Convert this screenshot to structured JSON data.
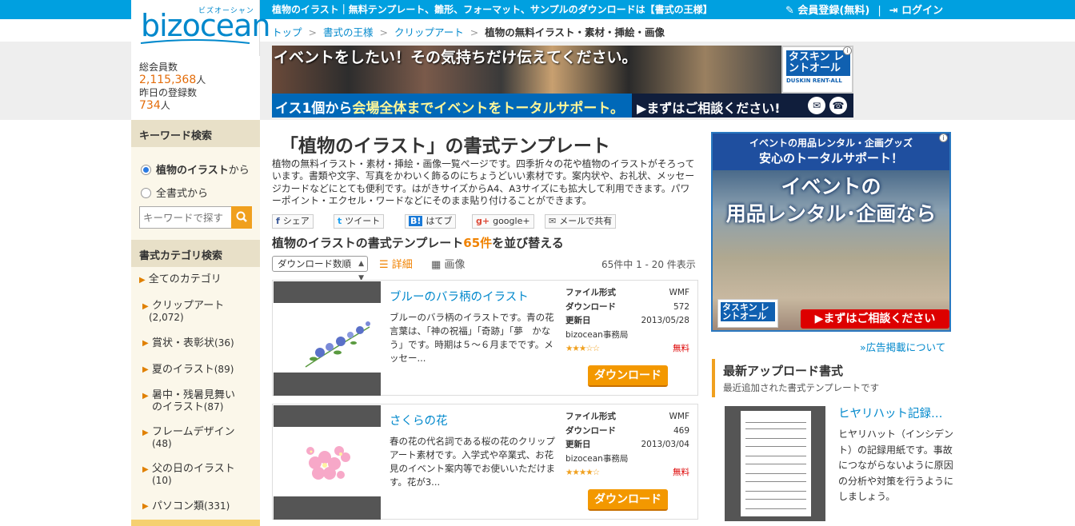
{
  "header": {
    "tagline": "植物のイラスト｜無料テンプレート、雛形、フォーマット、サンプルのダウンロードは【書式の王様】",
    "register": "会員登録(無料)",
    "separator": "|",
    "login": "ログイン"
  },
  "logo": {
    "brand": "bizocean",
    "kana": "ビズオーシャン"
  },
  "members": {
    "total_label": "総会員数",
    "total_value": "2,115,368",
    "unit": "人",
    "yesterday_label": "昨日の登録数",
    "yesterday_value": "734"
  },
  "breadcrumb": [
    "トップ",
    "書式の王様",
    "クリップアート",
    "植物の無料イラスト・素材・挿絵・画像"
  ],
  "banner_top": {
    "headline": "イベントをしたい！その気持ちだけ伝えてください。",
    "bar_text_a": "イス1個から",
    "bar_text_b": "会場全体まで",
    "bar_text_c": "イベントをトータルサポート。",
    "cta": "▶まずはご相談ください!",
    "logo_text": "タスキン レントオール",
    "logo_sub": "DUSKIN RENT-ALL"
  },
  "sidebar": {
    "keyword_head": "キーワード検索",
    "radio_this": "植物のイラスト",
    "radio_this_suffix": "から",
    "radio_all": "全書式から",
    "search_placeholder": "キーワードで探す",
    "category_head": "書式カテゴリ検索",
    "categories": [
      {
        "label": "全てのカテゴリ",
        "count": ""
      },
      {
        "label": "クリップアート",
        "count": "(2,072)"
      },
      {
        "label": "賞状・表彰状",
        "count": "(36)"
      },
      {
        "label": "夏のイラスト",
        "count": "(89)"
      },
      {
        "label": "暑中・残暑見舞いのイラスト",
        "count": "(87)"
      },
      {
        "label": "フレームデザイン",
        "count": "(48)"
      },
      {
        "label": "父の日のイラスト",
        "count": "(10)"
      },
      {
        "label": "パソコン類",
        "count": "(331)"
      }
    ]
  },
  "main": {
    "title": "「植物のイラスト」の書式テンプレート",
    "description": "植物の無料イラスト・素材・挿絵・画像一覧ページです。四季折々の花や植物のイラストがそろっています。書類や文字、写真をかわいく飾るのにちょうどいい素材です。案内状や、お礼状、メッセージカードなどにとても便利です。はがきサイズからA4、A3サイズにも拡大して利用できます。パワーポイント・エクセル・ワードなどにそのまま貼り付けることができます。",
    "share": [
      {
        "icon": "f",
        "label": "シェア"
      },
      {
        "icon": "t",
        "label": "ツイート"
      },
      {
        "icon": "B!",
        "label": "はてブ"
      },
      {
        "icon": "g+",
        "label": "google+"
      },
      {
        "icon": "✉",
        "label": "メールで共有"
      }
    ],
    "sort_title_a": "植物のイラストの書式テンプレート",
    "sort_count": "65件",
    "sort_title_b": "を並び替える",
    "sort_select": "ダウンロード数順",
    "view_detail": "詳細",
    "view_image": "画像",
    "range": "65件中 1 - 20 件表示",
    "items": [
      {
        "name": "ブルーのバラ柄のイラスト",
        "desc": "ブルーのバラ柄のイラストです。青の花言葉は、「神の祝福」「奇跡」「夢　かなう」です。時期は５～６月までです。メッセー...",
        "format_label": "ファイル形式",
        "format": "WMF",
        "downloads_label": "ダウンロード",
        "downloads": "572",
        "updated_label": "更新日",
        "updated": "2013/05/28",
        "author": "bizocean事務局",
        "rating": 3,
        "stars": "★★★☆☆",
        "price": "無料",
        "download_btn": "ダウンロード"
      },
      {
        "name": "さくらの花",
        "desc": "春の花の代名詞である桜の花のクリップアート素材です。入学式や卒業式、お花見のイベント案内等でお使いいただけます。花が3...",
        "format_label": "ファイル形式",
        "format": "WMF",
        "downloads_label": "ダウンロード",
        "downloads": "469",
        "updated_label": "更新日",
        "updated": "2013/03/04",
        "author": "bizocean事務局",
        "rating": 4,
        "stars": "★★★★☆",
        "price": "無料",
        "download_btn": "ダウンロード"
      }
    ]
  },
  "right": {
    "ad_top_a": "イベントの用品レンタル・企画グッズ",
    "ad_top_b": "安心のトータルサポート！",
    "ad_big_1": "イベントの",
    "ad_big_2": "用品レンタル･企画なら",
    "ad_logo": "タスキン レントオール",
    "ad_cta": "▶まずはご相談ください",
    "ad_link": "»広告掲載について",
    "latest_title": "最新アップロード書式",
    "latest_sub": "最近追加された書式テンプレートです",
    "latest_name": "ヒヤリハット記録…",
    "latest_desc": "ヒヤリハット（インシデント）の記録用紙です。事故につながらないように原因の分析や対策を行うようにしましょう。"
  }
}
